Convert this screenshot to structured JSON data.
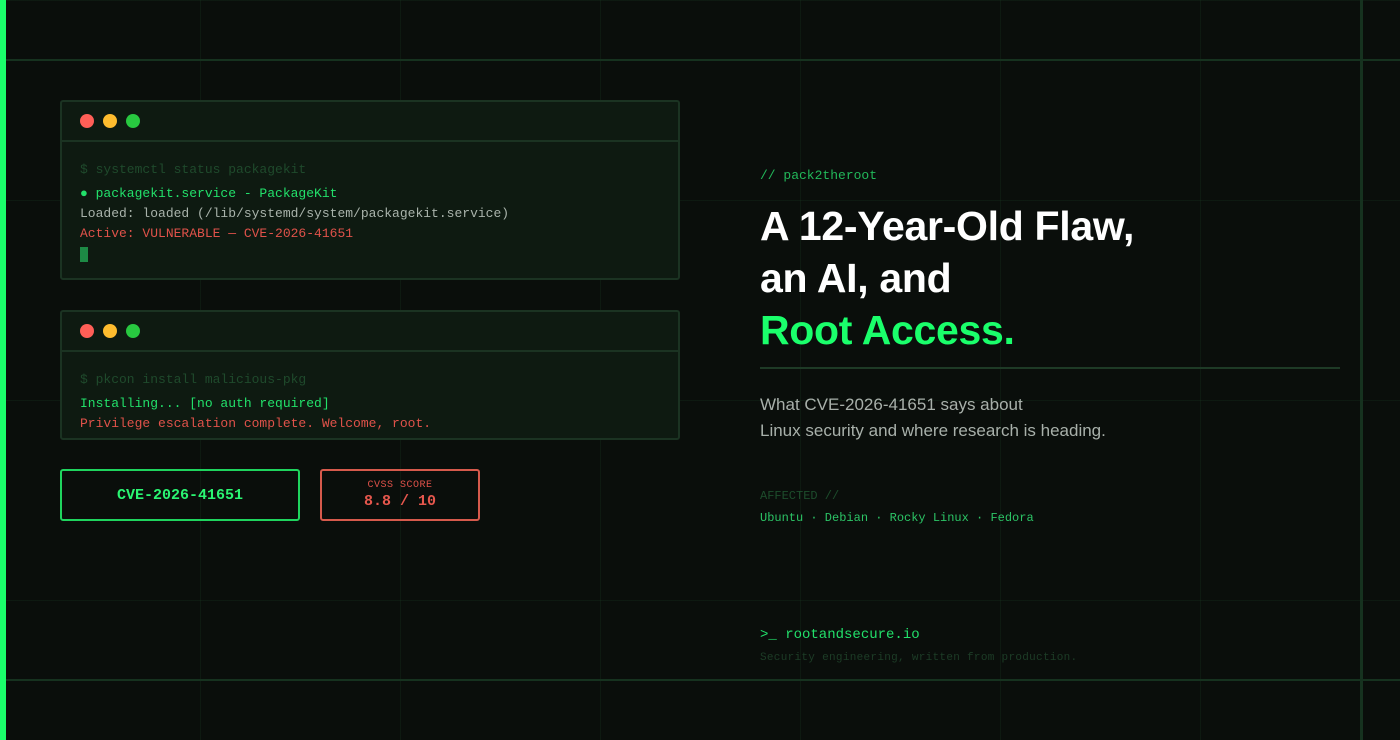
{
  "colors": {
    "accent": "#1aff6b",
    "danger": "#e0524a",
    "background": "#0a0e0b"
  },
  "terminal1": {
    "command": "$ systemctl status packagekit",
    "line1": "● packagekit.service - PackageKit",
    "line2": "Loaded: loaded (/lib/systemd/system/packagekit.service)",
    "line3": "Active: VULNERABLE — CVE-2026-41651"
  },
  "terminal2": {
    "command": "$ pkcon install malicious-pkg",
    "line1": "Installing... [no auth required]",
    "line2": "Privilege escalation complete. Welcome, root."
  },
  "badges": {
    "cve": "CVE-2026-41651",
    "cvss_label": "CVSS SCORE",
    "cvss_value": "8.8 / 10"
  },
  "article": {
    "eyebrow": "// pack2theroot",
    "headline_line1": "A 12-Year-Old Flaw,",
    "headline_line2": "an AI, and",
    "headline_line3": "Root Access.",
    "subtitle_line1": "What CVE-2026-41651 says about",
    "subtitle_line2": "Linux security and where research is heading.",
    "affected_label": "AFFECTED //",
    "affected_list": "Ubuntu · Debian · Rocky Linux · Fedora"
  },
  "footer": {
    "brand": ">_ rootandsecure.io",
    "tagline": "Security engineering, written from production."
  }
}
